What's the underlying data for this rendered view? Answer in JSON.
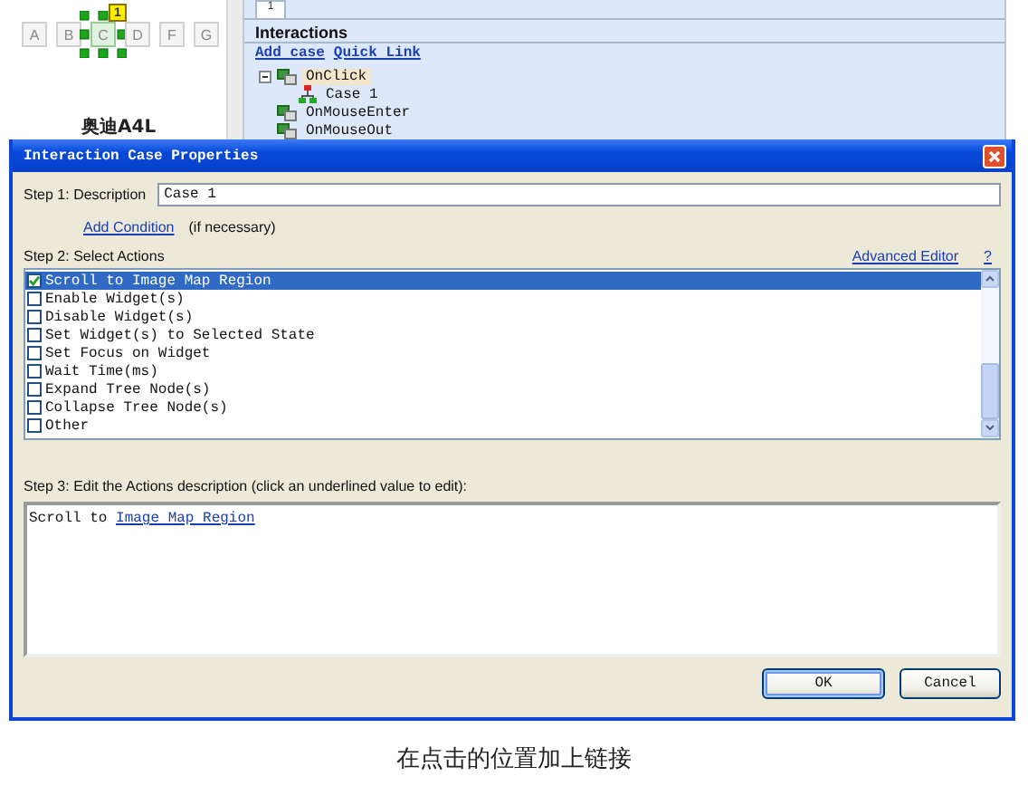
{
  "canvas": {
    "widget_buttons": [
      {
        "label": "A",
        "selected": false
      },
      {
        "label": "B",
        "selected": false
      },
      {
        "label": "C",
        "selected": true
      },
      {
        "label": "D",
        "selected": false
      },
      {
        "label": "F",
        "selected": false
      },
      {
        "label": "G",
        "selected": false
      }
    ],
    "badge": "1",
    "widget_label": "奥迪A4L"
  },
  "interactions_panel": {
    "tab": "1",
    "title": "Interactions",
    "links": [
      "Add case",
      "Quick Link"
    ],
    "tree": [
      {
        "label": "OnClick",
        "selected": true,
        "expanded": true,
        "children": [
          {
            "label": "Case 1",
            "selected": false
          }
        ]
      },
      {
        "label": "OnMouseEnter",
        "selected": false
      },
      {
        "label": "OnMouseOut",
        "selected": false
      }
    ]
  },
  "dialog": {
    "title": "Interaction Case Properties",
    "step1_label": "Step 1: Description",
    "description_value": "Case 1",
    "add_condition_link": "Add Condition",
    "condition_hint": "(if necessary)",
    "step2_label": "Step 2: Select Actions",
    "advanced_editor_link": "Advanced Editor",
    "help_link": "?",
    "actions": [
      {
        "label": "Scroll to Image Map Region",
        "checked": true,
        "selected": true
      },
      {
        "label": "Enable Widget(s)",
        "checked": false,
        "selected": false
      },
      {
        "label": "Disable Widget(s)",
        "checked": false,
        "selected": false
      },
      {
        "label": "Set Widget(s) to Selected State",
        "checked": false,
        "selected": false
      },
      {
        "label": "Set Focus on Widget",
        "checked": false,
        "selected": false
      },
      {
        "label": "Wait Time(ms)",
        "checked": false,
        "selected": false
      },
      {
        "label": "Expand Tree Node(s)",
        "checked": false,
        "selected": false
      },
      {
        "label": "Collapse Tree Node(s)",
        "checked": false,
        "selected": false
      },
      {
        "label": "Other",
        "checked": false,
        "selected": false
      }
    ],
    "step3_label": "Step 3: Edit the Actions description (click an underlined value to edit):",
    "action_description": {
      "text": "Scroll to",
      "link": "Image Map Region"
    },
    "buttons": [
      {
        "label": "OK",
        "default": true
      },
      {
        "label": "Cancel",
        "default": false
      }
    ]
  },
  "caption": "在点击的位置加上链接"
}
